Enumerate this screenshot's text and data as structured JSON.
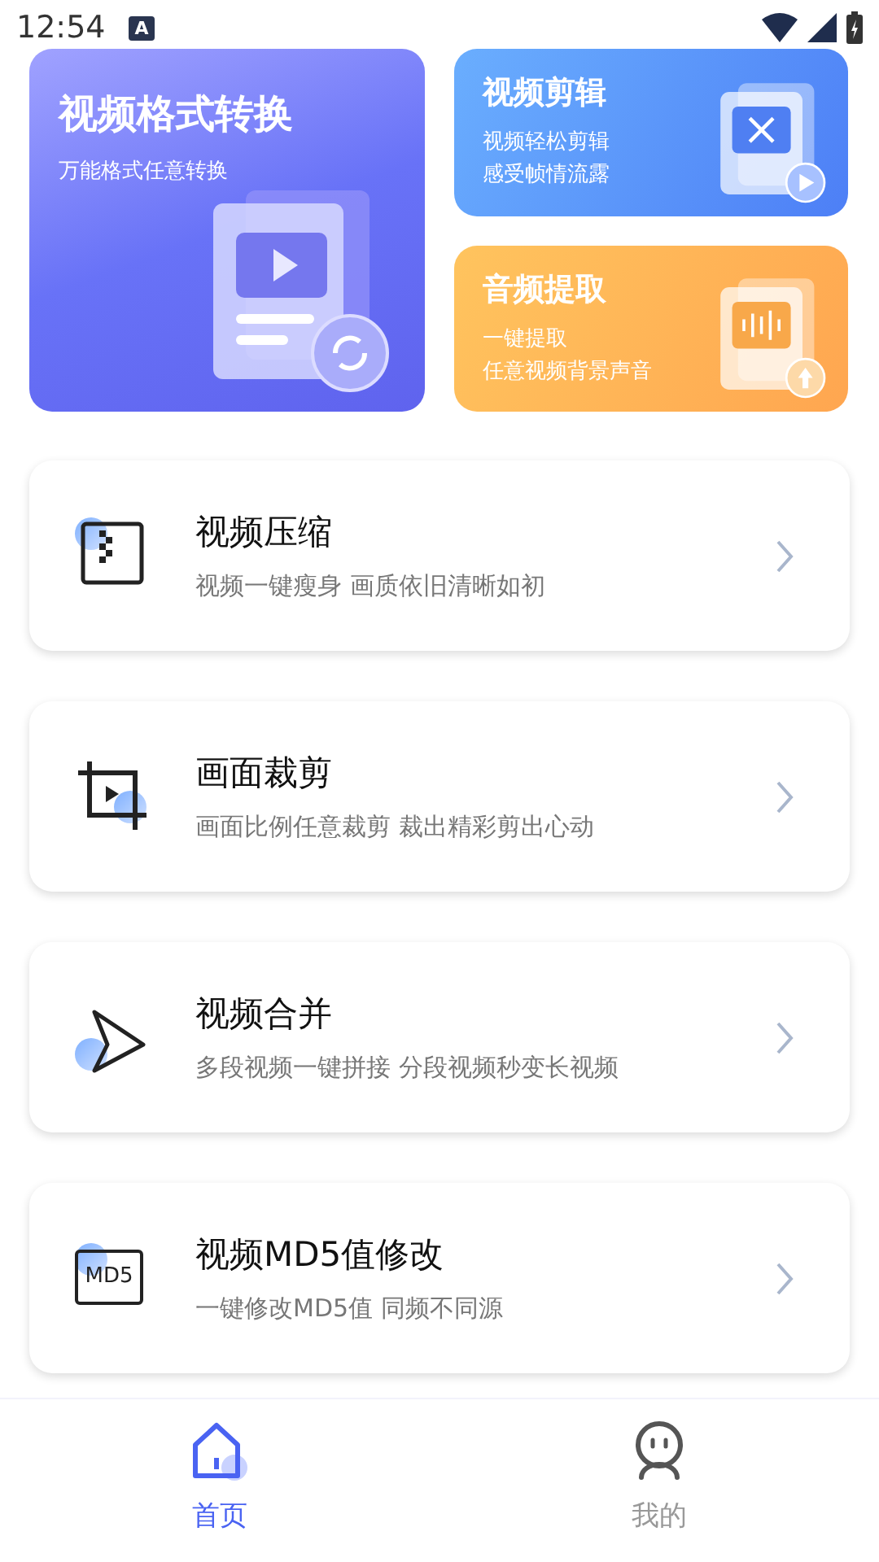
{
  "status_bar": {
    "time": "12:54",
    "input_badge": "A"
  },
  "banners": [
    {
      "kind": "convert",
      "title": "视频格式转换",
      "lines": [
        "万能格式任意转换"
      ]
    },
    {
      "kind": "edit",
      "title": "视频剪辑",
      "lines": [
        "视频轻松剪辑",
        "感受帧情流露"
      ]
    },
    {
      "kind": "audio",
      "title": "音频提取",
      "lines": [
        "一键提取",
        "任意视频背景声音"
      ]
    }
  ],
  "features": [
    {
      "kind": "compress",
      "title": "视频压缩",
      "subtitle": "视频一键瘦身 画质依旧清晰如初"
    },
    {
      "kind": "crop",
      "title": "画面裁剪",
      "subtitle": "画面比例任意裁剪 裁出精彩剪出心动"
    },
    {
      "kind": "merge",
      "title": "视频合并",
      "subtitle": "多段视频一键拼接 分段视频秒变长视频"
    },
    {
      "kind": "md5",
      "title": "视频MD5值修改",
      "subtitle": "一键修改MD5值 同频不同源",
      "icon_label": "MD5"
    }
  ],
  "tabs": [
    {
      "kind": "home",
      "label": "首页",
      "selected": true
    },
    {
      "kind": "profile",
      "label": "我的",
      "selected": false
    }
  ]
}
